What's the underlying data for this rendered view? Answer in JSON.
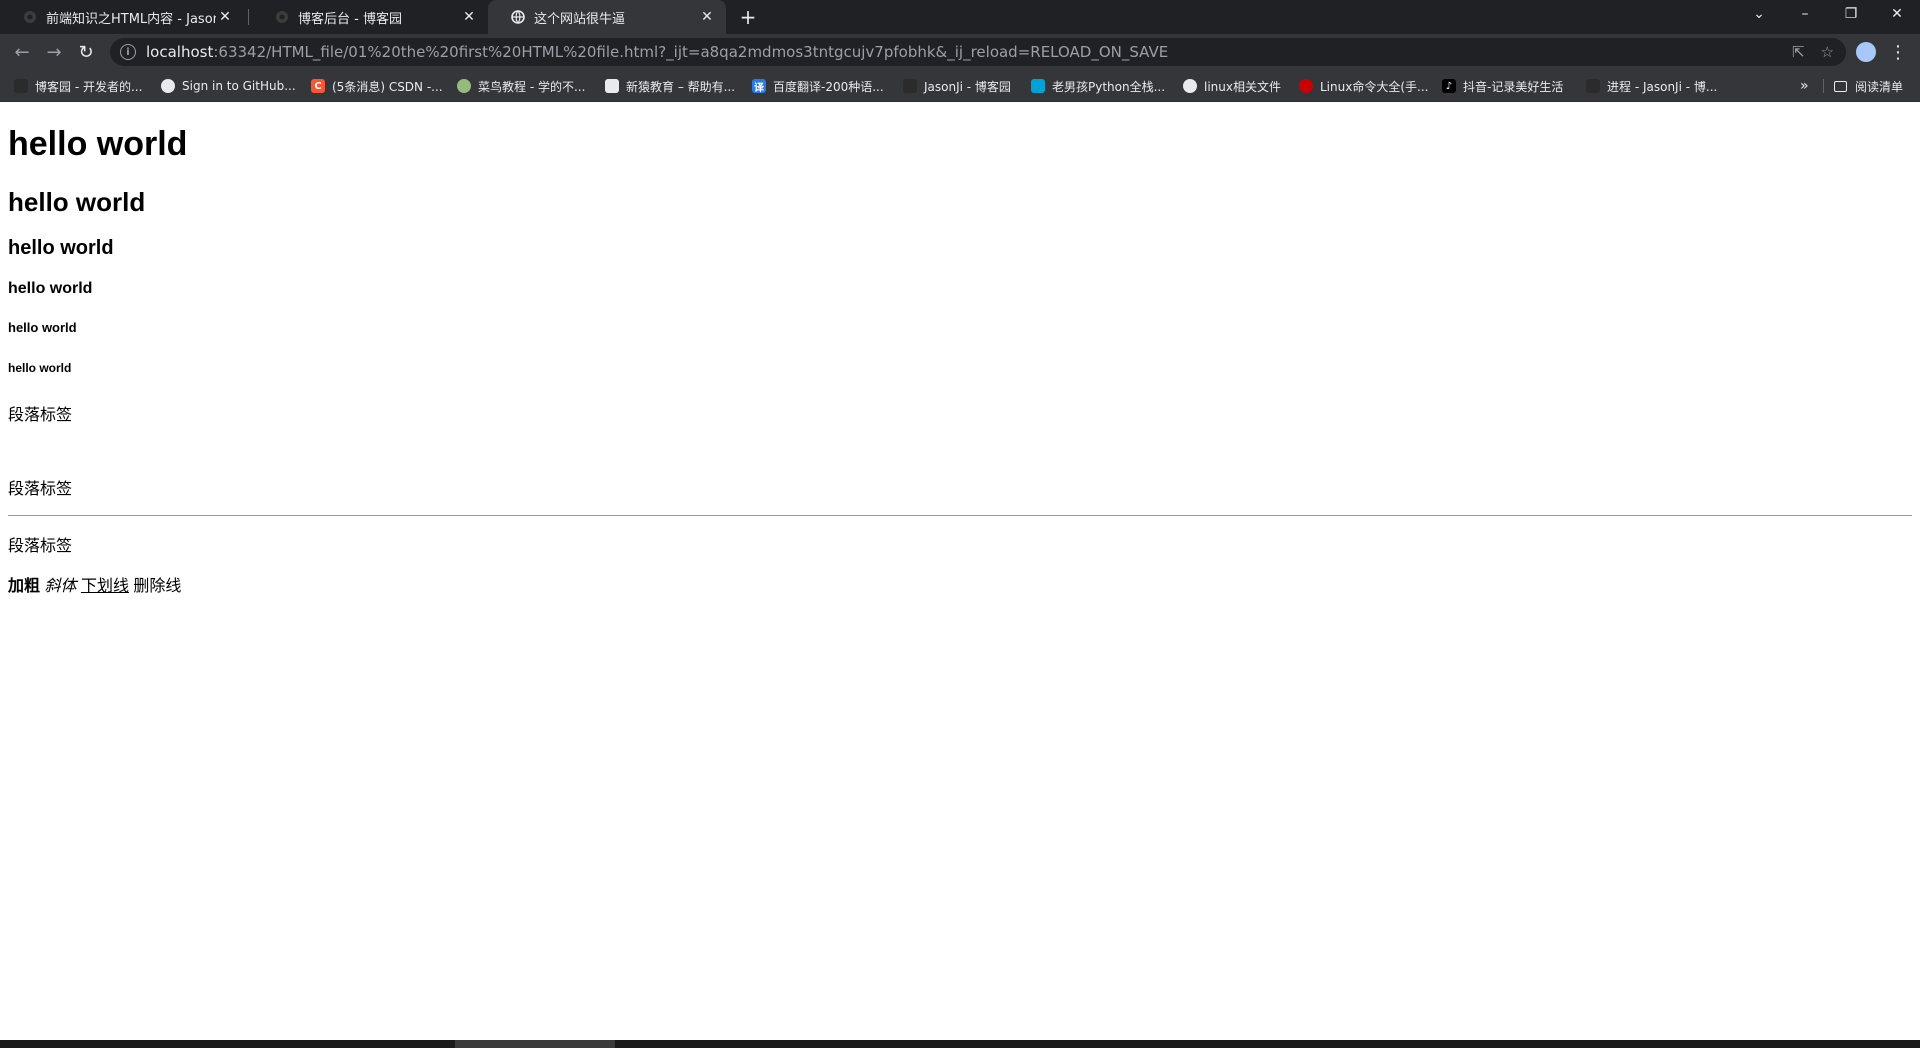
{
  "tabs": [
    {
      "title": "前端知识之HTML内容 - JasonJi",
      "icon": "cnblogs-icon"
    },
    {
      "title": "博客后台 - 博客园",
      "icon": "cnblogs-icon"
    },
    {
      "title": "这个网站很牛逼",
      "icon": "globe-icon",
      "active": true
    }
  ],
  "tab_close_glyph": "✕",
  "new_tab_glyph": "+",
  "window_controls": {
    "tab_search": "⌄",
    "minimize": "–",
    "restore": "❐",
    "close": "✕"
  },
  "toolbar": {
    "back_glyph": "←",
    "forward_glyph": "→",
    "reload_glyph": "↻",
    "url_host": "localhost",
    "url_rest": ":63342/HTML_file/01%20the%20first%20HTML%20file.html?_ijt=a8qa2mdmos3tntgcujv7pfobhk&_ij_reload=RELOAD_ON_SAVE",
    "info_glyph": "i",
    "share_glyph": "⇱",
    "star_glyph": "☆",
    "menu_glyph": "⋮"
  },
  "bookmarks": [
    {
      "label": "博客园 - 开发者的...",
      "icon": "cnblogs-icon",
      "color": "#2b2b2b"
    },
    {
      "label": "Sign in to GitHub...",
      "icon": "github-icon",
      "color": "#24292e"
    },
    {
      "label": "(5条消息) CSDN -...",
      "icon": "csdn-icon",
      "color": "#fc5531",
      "glyph": "C"
    },
    {
      "label": "菜鸟教程 - 学的不...",
      "icon": "runoob-icon",
      "color": "#96b97d"
    },
    {
      "label": "新猿教育 – 帮助有...",
      "icon": "xinyuan-icon",
      "color": "#e8eaed"
    },
    {
      "label": "百度翻译-200种语...",
      "icon": "baidu-translate-icon",
      "color": "#2a7ae4",
      "glyph": "译"
    },
    {
      "label": "JasonJi - 博客园",
      "icon": "cnblogs-icon",
      "color": "#2b2b2b"
    },
    {
      "label": "老男孩Python全栈...",
      "icon": "bilibili-icon",
      "color": "#00a1d6"
    },
    {
      "label": "linux相关文件",
      "icon": "globe-icon",
      "color": "#e8eaed"
    },
    {
      "label": "Linux命令大全(手...",
      "icon": "redhat-icon",
      "color": "#cc0000"
    },
    {
      "label": "抖音-记录美好生活",
      "icon": "douyin-icon",
      "color": "#000000",
      "glyph": "♪"
    },
    {
      "label": "进程 - JasonJi - 博...",
      "icon": "cnblogs-icon",
      "color": "#2b2b2b"
    }
  ],
  "bookmarks_more_glyph": "»",
  "reading_list_label": "阅读清单",
  "content": {
    "h1": "hello world",
    "h2": "hello world",
    "h3": "hello world",
    "h4": "hello world",
    "h5": "hello world",
    "h6": "hello world",
    "p1": "段落标签",
    "p2": "段落标签",
    "p3": "段落标签",
    "bold": "加粗",
    "italic": "斜体",
    "underline": "下划线",
    "strike": "删除线"
  }
}
